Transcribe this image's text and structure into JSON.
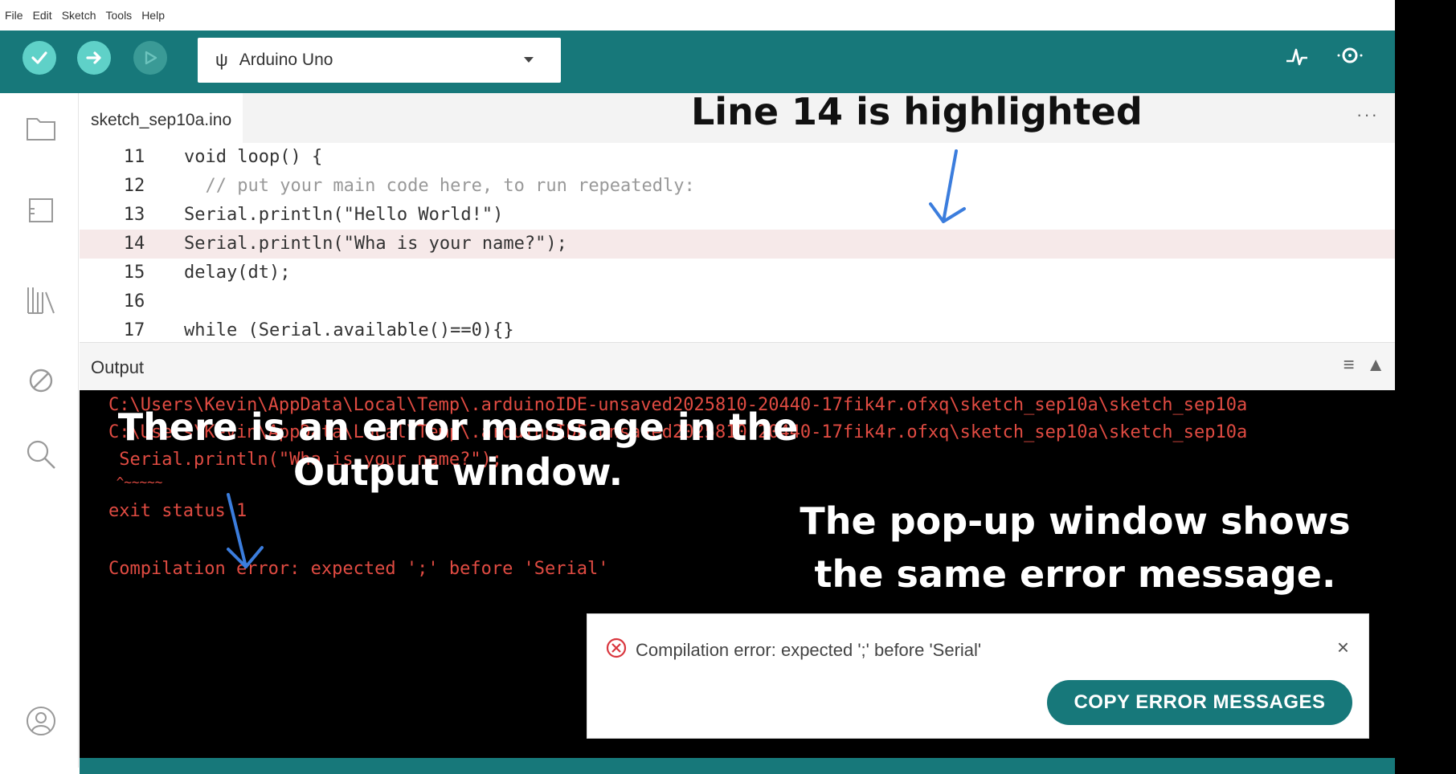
{
  "menu": [
    "File",
    "Edit",
    "Sketch",
    "Tools",
    "Help"
  ],
  "toolbar": {
    "board": "Arduino Uno",
    "verify_icon": "check-icon",
    "upload_icon": "arrow-right-icon",
    "debug_icon": "debug-icon",
    "plotter_icon": "pulse-icon",
    "monitor_icon": "magnifier-icon"
  },
  "sidebar": {
    "icons": [
      "folder-icon",
      "board-icon",
      "library-icon",
      "debug-off-icon",
      "search-icon",
      "account-icon"
    ]
  },
  "editor": {
    "tab": "sketch_sep10a.ino",
    "more": "···",
    "lines": [
      {
        "num": "11",
        "text": "void loop() {"
      },
      {
        "num": "12",
        "text": "  // put your main code here, to run repeatedly:"
      },
      {
        "num": "13",
        "text": "Serial.println(\"Hello World!\")"
      },
      {
        "num": "14",
        "text": "Serial.println(\"Wha is your name?\");",
        "highlighted": true
      },
      {
        "num": "15",
        "text": "delay(dt);"
      },
      {
        "num": "16",
        "text": ""
      },
      {
        "num": "17",
        "text": "while (Serial.available()==0){}"
      }
    ]
  },
  "output": {
    "title": "Output",
    "lines": [
      "C:\\Users\\Kevin\\AppData\\Local\\Temp\\.arduinoIDE-unsaved2025810-20440-17fik4r.ofxq\\sketch_sep10a\\sketch_sep10a",
      "C:\\Users\\Kevin\\AppData\\Local\\Temp\\.arduinoIDE-unsaved2025810-20440-17fik4r.ofxq\\sketch_sep10a\\sketch_sep10a",
      " Serial.println(\"Wha is your name?\");",
      " ^~~~~~",
      "exit status 1",
      "",
      "Compilation error: expected ';' before 'Serial'"
    ]
  },
  "popup": {
    "message": "Compilation error: expected ';' before 'Serial'",
    "close": "×",
    "button": "COPY ERROR MESSAGES"
  },
  "annotations": {
    "line14": "Line 14 is highlighted",
    "error": "There is an error message in the Output window.",
    "popup": "The pop-up window shows the same error message."
  },
  "colors": {
    "toolbar": "#17787a",
    "button_active": "#5fd1c8",
    "error_text": "#e04b42",
    "highlight": "#f6e9e9",
    "arrow": "#3b7ddd"
  }
}
